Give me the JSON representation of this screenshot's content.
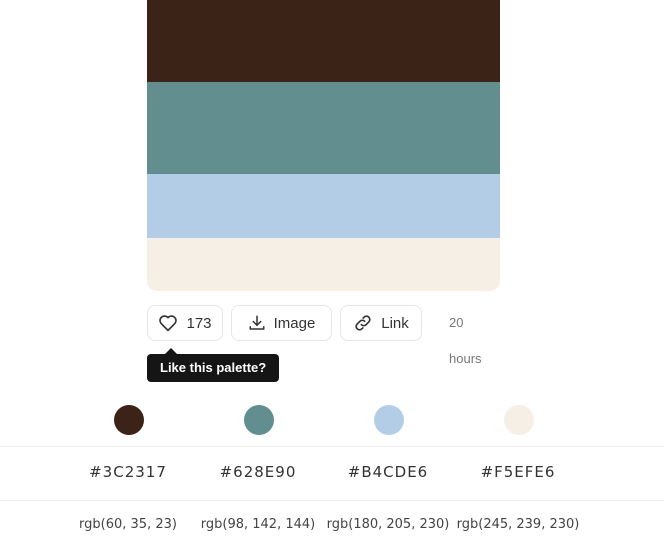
{
  "palette": {
    "colors": [
      {
        "hex": "#3C2317",
        "rgb": "rgb(60, 35, 23)"
      },
      {
        "hex": "#628E90",
        "rgb": "rgb(98, 142, 144)"
      },
      {
        "hex": "#B4CDE6",
        "rgb": "rgb(180, 205, 230)"
      },
      {
        "hex": "#F5EFE6",
        "rgb": "rgb(245, 239, 230)"
      }
    ]
  },
  "actions": {
    "likes": "173",
    "image_label": "Image",
    "link_label": "Link",
    "time_ago": "20 hours"
  },
  "tooltip": {
    "text": "Like this palette?"
  },
  "icons": {
    "like": "heart-icon",
    "image": "download-icon",
    "link": "link-icon"
  }
}
